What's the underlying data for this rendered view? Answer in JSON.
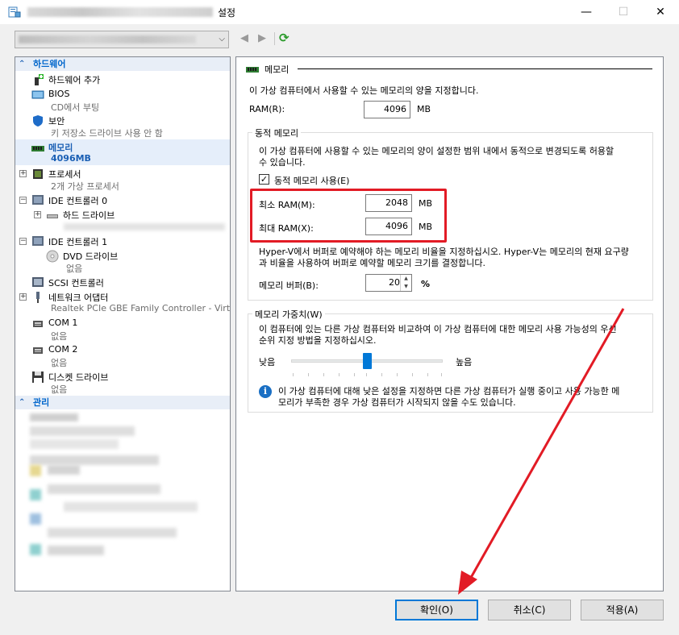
{
  "window": {
    "title_suffix": "설정",
    "min_glyph": "—",
    "max_glyph": "☐",
    "close_glyph": "✕"
  },
  "toolbar": {
    "back_glyph": "◀",
    "forward_glyph": "▶",
    "refresh_glyph": "⟳",
    "dropdown_glyph": "⌵"
  },
  "tree": {
    "hardware_header": "하드웨어",
    "management_header": "관리",
    "items": {
      "add_hardware": "하드웨어 추가",
      "bios": "BIOS",
      "bios_sub": "CD에서 부팅",
      "security": "보안",
      "security_sub": "키 저장소 드라이브 사용 안 함",
      "memory": "메모리",
      "memory_sub": "4096MB",
      "processor": "프로세서",
      "processor_sub": "2개 가상 프로세서",
      "ide0": "IDE 컨트롤러 0",
      "hdd": "하드 드라이브",
      "ide1": "IDE 컨트롤러 1",
      "dvd": "DVD 드라이브",
      "dvd_sub": "없음",
      "scsi": "SCSI 컨트롤러",
      "network": "네트워크 어댑터",
      "network_sub": "Realtek PCIe GBE Family Controller - Virtua...",
      "com1": "COM 1",
      "com1_sub": "없음",
      "com2": "COM 2",
      "com2_sub": "없음",
      "floppy": "디스켓 드라이브",
      "floppy_sub": "없음"
    }
  },
  "panel": {
    "header": "메모리",
    "description": "이 가상 컴퓨터에서 사용할 수 있는 메모리의 양을 지정합니다.",
    "ram_label": "RAM(R):",
    "ram_value": "4096",
    "mb": "MB",
    "dynamic_group": "동적 메모리",
    "dynamic_desc1": "이 가상 컴퓨터에 사용할 수 있는 메모리의 양이 설정한 범위 내에서 동적으로 변경되도록 허용할",
    "dynamic_desc2": "수 있습니다.",
    "dynamic_checkbox": "동적 메모리 사용(E)",
    "dynamic_checked": "✓",
    "min_ram_label": "최소 RAM(M):",
    "min_ram_value": "2048",
    "max_ram_label": "최대 RAM(X):",
    "max_ram_value": "4096",
    "buffer_desc1": "Hyper-V에서 버퍼로 예약해야 하는 메모리 비율을 지정하십시오. Hyper-V는 메모리의 현재 요구량",
    "buffer_desc2": "과 비율을 사용하여 버퍼로 예약할 메모리 크기를 결정합니다.",
    "buffer_label": "메모리 버퍼(B):",
    "buffer_value": "20",
    "percent": "%",
    "weight_group": "메모리 가중치(W)",
    "weight_desc1": "이 컴퓨터에 있는 다른 가상 컴퓨터와 비교하여 이 가상 컴퓨터에 대한 메모리 사용 가능성의 우선",
    "weight_desc2": "순위 지정 방법을 지정하십시오.",
    "weight_low": "낮음",
    "weight_high": "높음",
    "weight_level": 0.5,
    "info1": "이 가상 컴퓨터에 대해 낮은 설정을 지정하면 다른 가상 컴퓨터가 실행 중이고 사용 가능한 메",
    "info2": "모리가 부족한 경우 가상 컴퓨터가 시작되지 않을 수도 있습니다.",
    "info_glyph": "i"
  },
  "buttons": {
    "ok": "확인(O)",
    "cancel": "취소(C)",
    "apply": "적용(A)"
  },
  "colors": {
    "highlight_box": "#e21b25",
    "annotation_arrow": "#e21b25",
    "accent": "#0078d7"
  }
}
